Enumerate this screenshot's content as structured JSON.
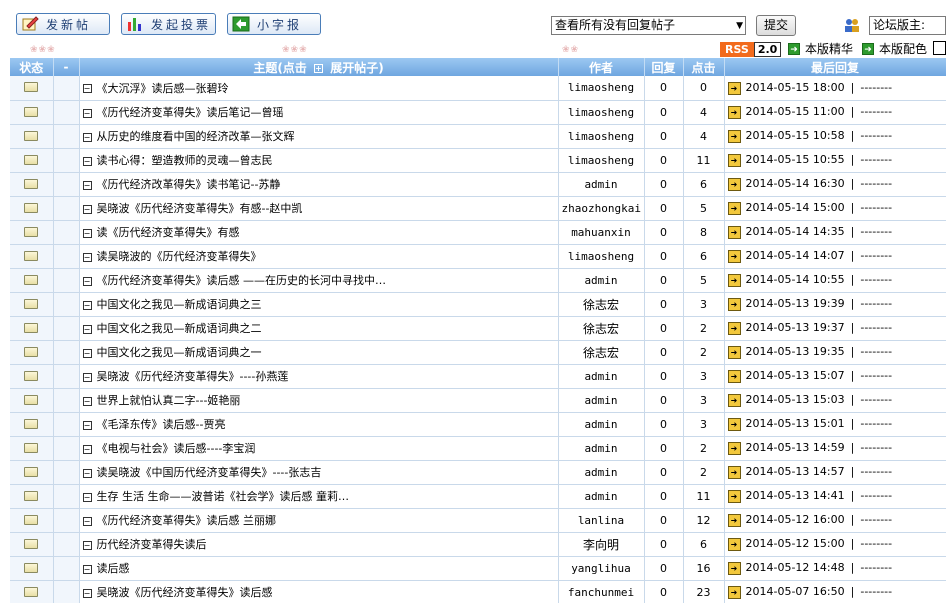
{
  "toolbar": {
    "new_post": "发新帖",
    "new_vote": "发起投票",
    "small_font": "小字报",
    "filter_value": "查看所有没有回复帖子",
    "submit": "提交",
    "moderator_select": "论坛版主:",
    "rss_label": "RSS",
    "rss_version": "2.0",
    "elite_link": "本版精华",
    "color_link": "本版配色"
  },
  "table": {
    "headers": {
      "status": "状态",
      "dash": "-",
      "title_prefix": "主题(点击",
      "title_suffix": "展开帖子)",
      "author": "作者",
      "replies": "回复",
      "clicks": "点击",
      "last_reply": "最后回复"
    },
    "rows": [
      {
        "title": "《大沉浮》读后感—张碧玲",
        "author": "limaosheng",
        "replies": "0",
        "clicks": "0",
        "last": "2014-05-15 18:00",
        "last_by": "--------"
      },
      {
        "title": "《历代经济变革得失》读后笔记—曾瑶",
        "author": "limaosheng",
        "replies": "0",
        "clicks": "4",
        "last": "2014-05-15 11:00",
        "last_by": "--------"
      },
      {
        "title": "从历史的维度看中国的经济改革—张文辉",
        "author": "limaosheng",
        "replies": "0",
        "clicks": "4",
        "last": "2014-05-15 10:58",
        "last_by": "--------"
      },
      {
        "title": "读书心得：塑造教师的灵魂—曾志民",
        "author": "limaosheng",
        "replies": "0",
        "clicks": "11",
        "last": "2014-05-15 10:55",
        "last_by": "--------"
      },
      {
        "title": "《历代经济改革得失》读书笔记--苏静",
        "author": "admin",
        "replies": "0",
        "clicks": "6",
        "last": "2014-05-14 16:30",
        "last_by": "--------"
      },
      {
        "title": "吴晓波《历代经济变革得失》有感--赵中凯",
        "author": "zhaozhongkai",
        "replies": "0",
        "clicks": "5",
        "last": "2014-05-14 15:00",
        "last_by": "--------"
      },
      {
        "title": "读《历代经济变革得失》有感",
        "author": "mahuanxin",
        "replies": "0",
        "clicks": "8",
        "last": "2014-05-14 14:35",
        "last_by": "--------"
      },
      {
        "title": "读吴晓波的《历代经济变革得失》",
        "author": "limaosheng",
        "replies": "0",
        "clicks": "6",
        "last": "2014-05-14 14:07",
        "last_by": "--------"
      },
      {
        "title": "《历代经济变革得失》读后感 ——在历史的长河中寻找中…",
        "author": "admin",
        "replies": "0",
        "clicks": "5",
        "last": "2014-05-14 10:55",
        "last_by": "--------"
      },
      {
        "title": "中国文化之我见—新成语词典之三",
        "author": "徐志宏",
        "replies": "0",
        "clicks": "3",
        "last": "2014-05-13 19:39",
        "last_by": "--------"
      },
      {
        "title": "中国文化之我见—新成语词典之二",
        "author": "徐志宏",
        "replies": "0",
        "clicks": "2",
        "last": "2014-05-13 19:37",
        "last_by": "--------"
      },
      {
        "title": "中国文化之我见—新成语词典之一",
        "author": "徐志宏",
        "replies": "0",
        "clicks": "2",
        "last": "2014-05-13 19:35",
        "last_by": "--------"
      },
      {
        "title": "吴晓波《历代经济变革得失》----孙燕莲",
        "author": "admin",
        "replies": "0",
        "clicks": "3",
        "last": "2014-05-13 15:07",
        "last_by": "--------"
      },
      {
        "title": "世界上就怕认真二字---姬艳丽",
        "author": "admin",
        "replies": "0",
        "clicks": "3",
        "last": "2014-05-13 15:03",
        "last_by": "--------"
      },
      {
        "title": "《毛泽东传》读后感--贾亮",
        "author": "admin",
        "replies": "0",
        "clicks": "3",
        "last": "2014-05-13 15:01",
        "last_by": "--------"
      },
      {
        "title": "《电视与社会》读后感----李宝润",
        "author": "admin",
        "replies": "0",
        "clicks": "2",
        "last": "2014-05-13 14:59",
        "last_by": "--------"
      },
      {
        "title": "读吴晓波《中国历代经济变革得失》----张志吉",
        "author": "admin",
        "replies": "0",
        "clicks": "2",
        "last": "2014-05-13 14:57",
        "last_by": "--------"
      },
      {
        "title": "生存 生活 生命——波普诺《社会学》读后感 童莉…",
        "author": "admin",
        "replies": "0",
        "clicks": "11",
        "last": "2014-05-13 14:41",
        "last_by": "--------"
      },
      {
        "title": "《历代经济变革得失》读后感 兰丽娜",
        "author": "lanlina",
        "replies": "0",
        "clicks": "12",
        "last": "2014-05-12 16:00",
        "last_by": "--------"
      },
      {
        "title": "历代经济变革得失读后",
        "author": "李向明",
        "replies": "0",
        "clicks": "6",
        "last": "2014-05-12 15:00",
        "last_by": "--------"
      },
      {
        "title": "读后感",
        "author": "yanglihua",
        "replies": "0",
        "clicks": "16",
        "last": "2014-05-12 14:48",
        "last_by": "--------"
      },
      {
        "title": "吴晓波《历代经济变革得失》读后感",
        "author": "fanchunmei",
        "replies": "0",
        "clicks": "23",
        "last": "2014-05-07 16:50",
        "last_by": "--------"
      }
    ]
  }
}
